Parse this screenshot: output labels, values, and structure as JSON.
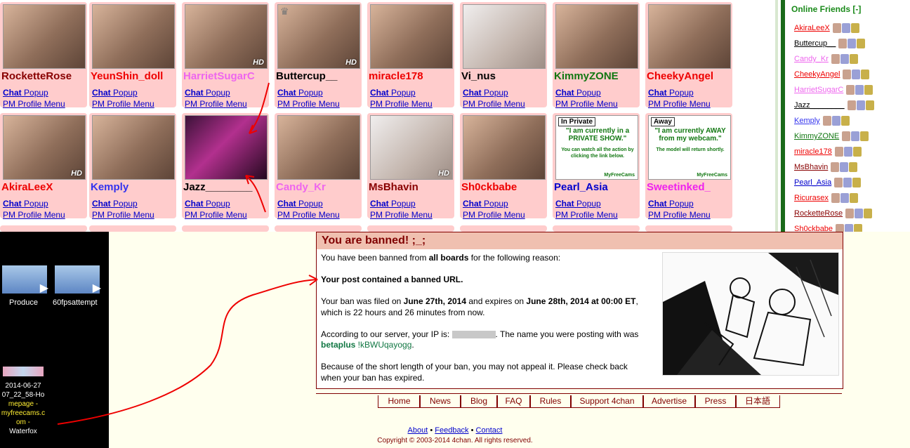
{
  "models": [
    {
      "name": "RocketteRose",
      "color": "#880000",
      "hd": false
    },
    {
      "name": "YeunShin_doll",
      "color": "#ee0000",
      "hd": false
    },
    {
      "name": "HarrietSugarC",
      "color": "#ee66ee",
      "hd": true
    },
    {
      "name": "Buttercup__",
      "color": "#000000",
      "hd": true
    },
    {
      "name": "miracle178",
      "color": "#ee0000",
      "hd": false
    },
    {
      "name": "Vi_nus",
      "color": "#000000",
      "hd": false
    },
    {
      "name": "KimmyZONE",
      "color": "#117711",
      "hd": false
    },
    {
      "name": "CheekyAngel",
      "color": "#ee0000",
      "hd": false
    },
    {
      "name": "AkiraLeeX",
      "color": "#ee0000",
      "hd": true
    },
    {
      "name": "Kemply",
      "color": "#3333ee",
      "hd": false
    },
    {
      "name": "Jazz________",
      "color": "#000000",
      "hd": false
    },
    {
      "name": "Candy_Kr",
      "color": "#ee66ee",
      "hd": false
    },
    {
      "name": "MsBhavin",
      "color": "#880000",
      "hd": true
    },
    {
      "name": "Sh0ckbabe",
      "color": "#ee0000",
      "hd": false
    },
    {
      "name": "Pearl_Asia",
      "color": "#0000cc",
      "hd": false
    },
    {
      "name": "Sweetinked_",
      "color": "#ee22ee",
      "hd": false
    }
  ],
  "links": {
    "chat": "Chat",
    "popup": "Popup",
    "pm": "PM",
    "profile": "Profile",
    "menu": "Menu"
  },
  "hd_label": "HD",
  "promo": [
    {
      "tag": "In Private",
      "headline": "\"I am currently in a PRIVATE SHOW.\"",
      "detail": "You can watch all the action by clicking the link below.",
      "brand": "MyFreeCams"
    },
    {
      "tag": "Away",
      "headline": "\"I am currently AWAY from my webcam.\"",
      "detail": "The model will return shortly.",
      "brand": "MyFreeCams"
    }
  ],
  "friends": {
    "title": "Online Friends [-]",
    "items": [
      {
        "name": "AkiraLeeX",
        "color": "#ee0000"
      },
      {
        "name": "Buttercup__",
        "color": "#000000"
      },
      {
        "name": "Candy_Kr",
        "color": "#ee66ee"
      },
      {
        "name": "CheekyAngel",
        "color": "#ee0000"
      },
      {
        "name": "HarrietSugarC",
        "color": "#ee66ee"
      },
      {
        "name": "Jazz________",
        "color": "#000000"
      },
      {
        "name": "Kemply",
        "color": "#3333ee"
      },
      {
        "name": "KimmyZONE",
        "color": "#117711"
      },
      {
        "name": "miracle178",
        "color": "#ee0000"
      },
      {
        "name": "MsBhavin",
        "color": "#880000"
      },
      {
        "name": "Pearl_Asia",
        "color": "#0000cc"
      },
      {
        "name": "Ricurasex",
        "color": "#ee0000"
      },
      {
        "name": "RocketteRose",
        "color": "#880000"
      },
      {
        "name": "Sh0ckbabe",
        "color": "#ee0000"
      }
    ]
  },
  "desktop": {
    "videos": [
      {
        "label": "Produce"
      },
      {
        "label": "60fpsattempt"
      }
    ],
    "download_line1": "2014-06-27",
    "download_line2": "07_22_58-Ho",
    "download_line3": "mepage -",
    "download_line4": "myfreecams.c",
    "download_line5": "om -",
    "download_line6": "Waterfox"
  },
  "ban": {
    "title": "You are banned! ;_;",
    "line1_pre": "You have been banned from ",
    "line1_bold": "all boards",
    "line1_post": " for the following reason:",
    "reason": "Your post contained a banned URL.",
    "filed_pre": "Your ban was filed on ",
    "filed_date": "June 27th, 2014",
    "filed_mid": " and expires on ",
    "expires": "June 28th, 2014 at 00:00 ET",
    "filed_post": ",",
    "remaining": "which is 22 hours and 26 minutes from now.",
    "ip_pre": "According to our server, your IP is: ",
    "ip_post": ". The name you were posting with was",
    "poster_name": "betaplus",
    "poster_trip": " !kBWUqayogg",
    "poster_end": ".",
    "appeal1": "Because of the short length of your ban, you may not appeal it. Please check back",
    "appeal2": "when your ban has expired."
  },
  "nav": [
    "Home",
    "News",
    "Blog",
    "FAQ",
    "Rules",
    "Support 4chan",
    "Advertise",
    "Press",
    "日本語"
  ],
  "footer": {
    "about": "About",
    "feedback": "Feedback",
    "contact": "Contact",
    "sep": " • ",
    "copyright": "Copyright © 2003-2014 4chan. All rights reserved."
  },
  "colors": {
    "ban_border": "#800000",
    "friend_bar": "#1a6a1a",
    "tile_bg": "#ffcccc",
    "link": "#0000cc"
  }
}
